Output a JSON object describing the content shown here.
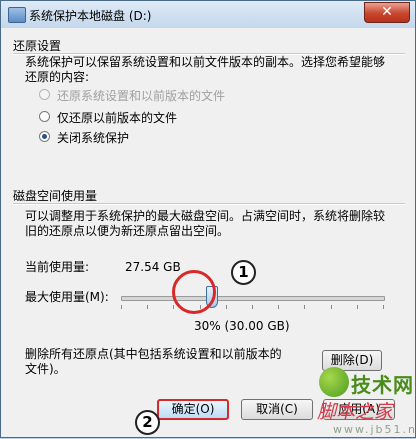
{
  "window": {
    "title": "系统保护本地磁盘 (D:)",
    "close_glyph": "✕"
  },
  "restore": {
    "group_label": "还原设置",
    "description": [
      "系统保护可以保留系统设置和以前文件版本的副本。选择您希望能够",
      "还原的内容:"
    ],
    "options": [
      {
        "label": "还原系统设置和以前版本的文件",
        "state": "disabled"
      },
      {
        "label": "仅还原以前版本的文件",
        "state": "unchecked"
      },
      {
        "label": "关闭系统保护",
        "state": "checked"
      }
    ]
  },
  "disk": {
    "group_label": "磁盘空间使用量",
    "description": [
      "可以调整用于系统保护的最大磁盘空间。占满空间时，系统将删除较",
      "旧的还原点以便为新还原点留出空间。"
    ],
    "current_label": "当前使用量:",
    "current_value": "27.54 GB",
    "max_label": "最大使用量(M):",
    "slider_value_text": "30% (30.00 GB)",
    "slider_percent": 30
  },
  "delete": {
    "text": [
      "删除所有还原点(其中包括系统设置和以前版本的",
      "文件)。"
    ],
    "button_label": "删除(D)"
  },
  "footer": {
    "ok_label": "确定(O)",
    "cancel_label": "取消(C)",
    "apply_label": "应用(A)"
  },
  "annotations": {
    "marker1": "1",
    "marker2": "2"
  },
  "watermark": {
    "text1": "技术网",
    "text2": "脚本之家",
    "text3": "www.jb51.net"
  }
}
